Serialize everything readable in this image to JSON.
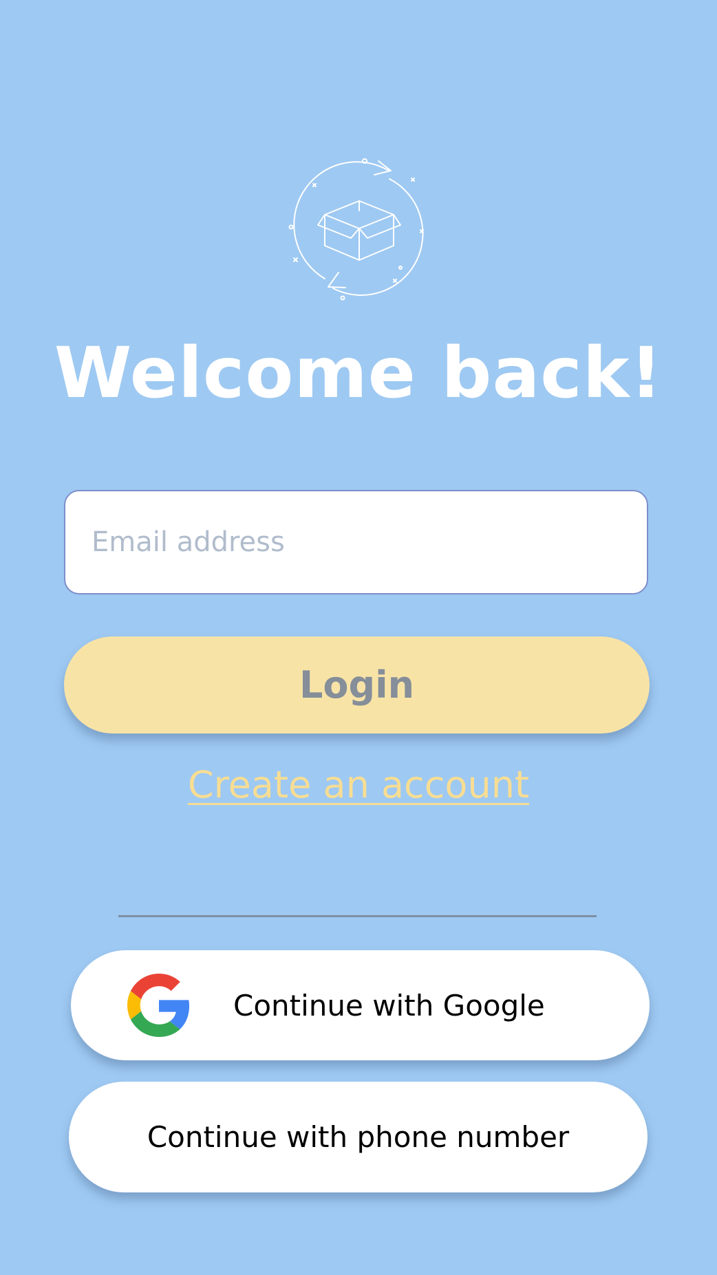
{
  "app": {
    "background_color": "#9ec9f2"
  },
  "logo": {
    "icon": "box-refresh-icon"
  },
  "header": {
    "title": "Welcome back!"
  },
  "form": {
    "email_placeholder": "Email address",
    "email_value": "",
    "login_label": "Login",
    "create_account_label": "Create an account"
  },
  "social": {
    "google_label": "Continue with Google",
    "google_icon": "google-icon",
    "phone_label": "Continue with phone number"
  },
  "colors": {
    "accent_yellow": "#f8e3a7",
    "link_yellow": "#f8dd93",
    "field_border": "#7c8ecb"
  }
}
